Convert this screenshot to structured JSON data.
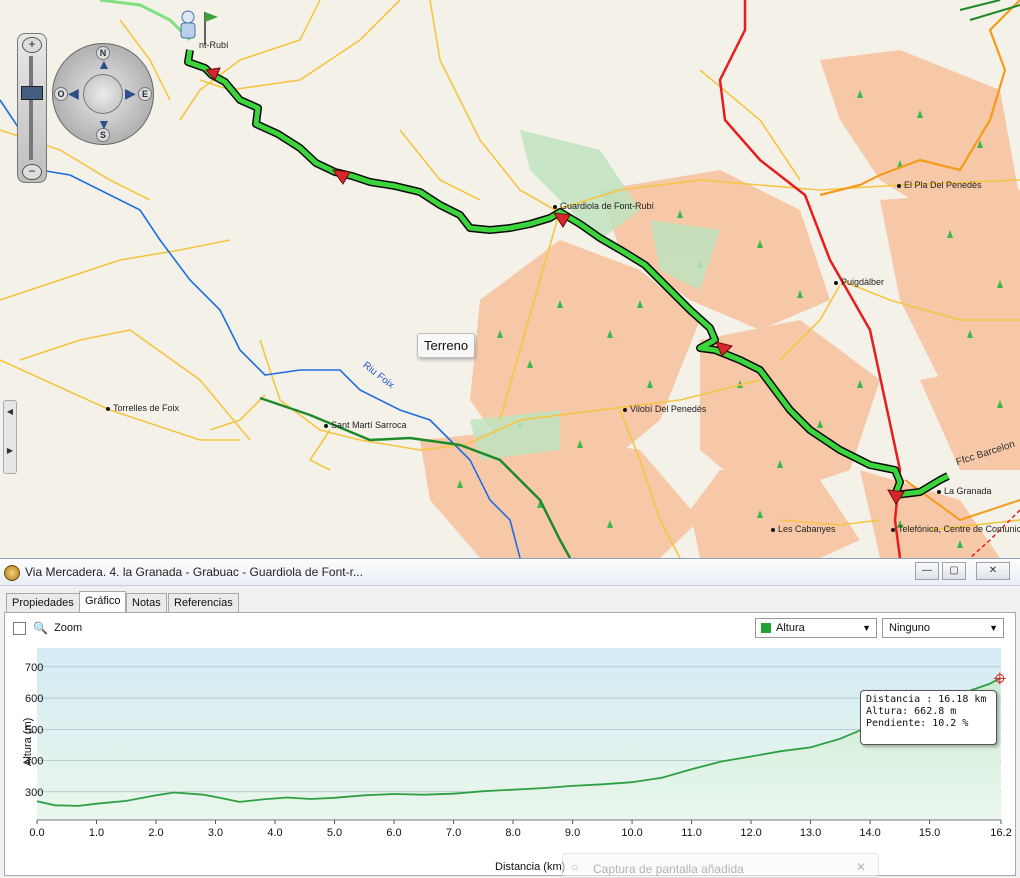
{
  "map": {
    "overlay_button": "Terreno",
    "river_label": "Riu Foix",
    "rail_label": "Ffcc Barcelon",
    "places": [
      {
        "name": "nt-Rubí"
      },
      {
        "name": "Guardiola de Font-Rubí"
      },
      {
        "name": "El Pla Del Penedès"
      },
      {
        "name": "Puigdàlber"
      },
      {
        "name": "Torrelles de Foix"
      },
      {
        "name": "Sant Martí Sarroca"
      },
      {
        "name": "Vilobí Del Penedès"
      },
      {
        "name": "La Granada"
      },
      {
        "name": "Les Cabanyes"
      },
      {
        "name": "Telefónica, Centre de Comunic"
      }
    ],
    "compass": {
      "n": "N",
      "s": "S",
      "e": "E",
      "w": "O"
    },
    "zoom_in": "+",
    "zoom_out": "−",
    "colors": {
      "route": "#3cd43c",
      "road_main": "#e81c1c",
      "road_secondary": "#f59a1a",
      "road_local": "#f5c542",
      "river": "#1e6ee0",
      "forest": "#f7c8a8",
      "tree_symbol": "#3cb84a"
    }
  },
  "window": {
    "title": "Via Mercadera. 4. la Granada - Grabuac - Guardiola de Font-r...",
    "minimize": "—",
    "restore": "▢",
    "close": "✕"
  },
  "tabs": [
    {
      "label": "Propiedades"
    },
    {
      "label": "Gráfico"
    },
    {
      "label": "Notas"
    },
    {
      "label": "Referencias"
    }
  ],
  "toolbar": {
    "zoom_label": "Zoom",
    "series_select": "Altura",
    "secondary_select": "Ninguno"
  },
  "tooltip": {
    "line1": "Distancia : 16.18 km",
    "line2": "Altura: 662.8 m",
    "line3": "Pendiente: 10.2 %"
  },
  "toast": {
    "text": "Captura de pantalla añadida"
  },
  "chart_data": {
    "type": "area",
    "title": "",
    "xlabel": "Distancia  (km)",
    "ylabel": "Altura (m)",
    "xlim": [
      0,
      16.2
    ],
    "ylim": [
      210,
      760
    ],
    "x_ticks": [
      "0.0",
      "1.0",
      "2.0",
      "3.0",
      "4.0",
      "5.0",
      "6.0",
      "7.0",
      "8.0",
      "9.0",
      "10.0",
      "11.0",
      "12.0",
      "13.0",
      "14.0",
      "15.0",
      "16.2"
    ],
    "y_ticks": [
      300,
      400,
      500,
      600,
      700
    ],
    "grid": "horizontal",
    "series": [
      {
        "name": "Altura",
        "color": "#2ea043",
        "x": [
          0.0,
          0.3,
          0.7,
          1.0,
          1.5,
          2.0,
          2.3,
          2.8,
          3.1,
          3.4,
          3.8,
          4.2,
          4.6,
          5.0,
          5.5,
          6.0,
          6.5,
          7.0,
          7.5,
          8.0,
          8.5,
          9.0,
          9.5,
          10.0,
          10.5,
          11.0,
          11.5,
          12.0,
          12.5,
          13.0,
          13.5,
          14.0,
          14.5,
          15.0,
          15.5,
          16.0,
          16.18
        ],
        "y": [
          270,
          257,
          255,
          262,
          271,
          289,
          298,
          291,
          280,
          268,
          276,
          282,
          277,
          281,
          289,
          293,
          291,
          294,
          302,
          307,
          312,
          319,
          324,
          331,
          345,
          372,
          397,
          413,
          430,
          442,
          470,
          510,
          545,
          580,
          612,
          645,
          662.8
        ]
      }
    ]
  }
}
